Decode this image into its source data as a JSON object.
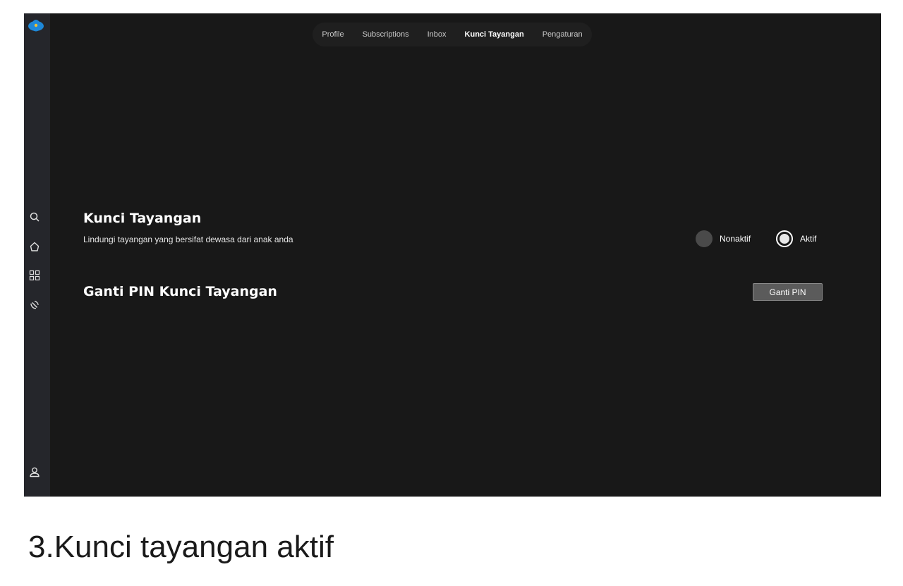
{
  "colors": {
    "background": "#181818",
    "sidebar": "#25262b",
    "logo": "#1e88d8",
    "text": "#ffffff",
    "button": "#5b5b5b"
  },
  "sidebar": {
    "logo_icon": "logo-icon",
    "icons": [
      "search-icon",
      "home-icon",
      "grid-icon",
      "satellite-icon",
      "user-icon"
    ]
  },
  "topnav": {
    "items": [
      {
        "label": "Profile",
        "active": false
      },
      {
        "label": "Subscriptions",
        "active": false
      },
      {
        "label": "Inbox",
        "active": false
      },
      {
        "label": "Kunci Tayangan",
        "active": true
      },
      {
        "label": "Pengaturan",
        "active": false
      }
    ]
  },
  "parental_lock": {
    "title": "Kunci Tayangan",
    "description": "Lindungi tayangan yang bersifat dewasa dari anak anda",
    "options": [
      {
        "label": "Nonaktif",
        "selected": false
      },
      {
        "label": "Aktif",
        "selected": true
      }
    ]
  },
  "change_pin": {
    "title": "Ganti PIN Kunci Tayangan",
    "button_label": "Ganti PIN"
  },
  "caption": "3.Kunci tayangan aktif"
}
